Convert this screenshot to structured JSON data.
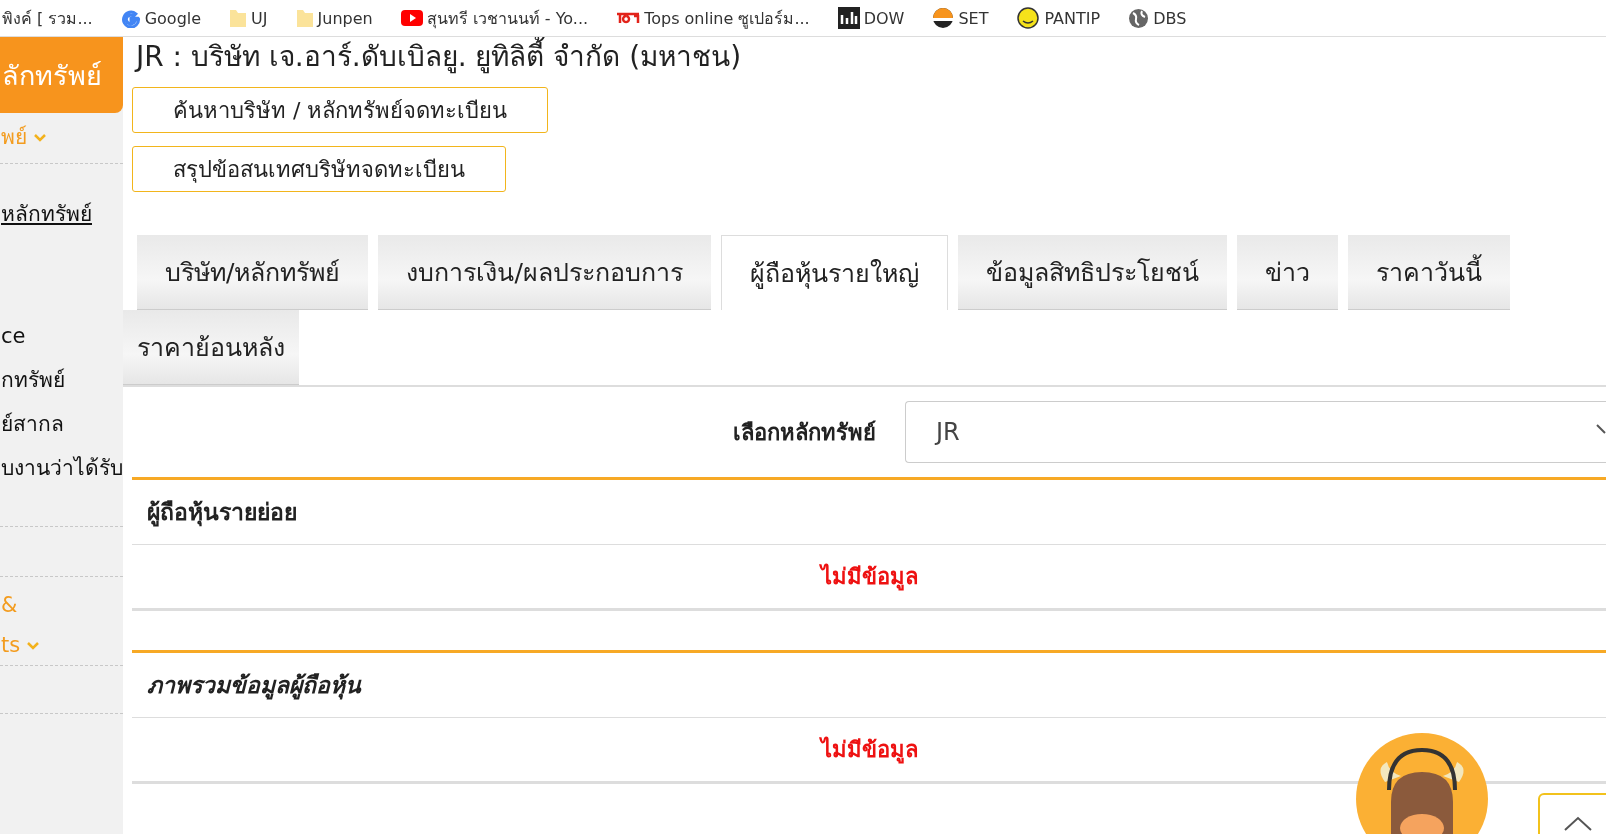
{
  "bookmarks": [
    {
      "label": "พิงค์ [ รวม...",
      "kind": "none"
    },
    {
      "label": "Google",
      "kind": "google"
    },
    {
      "label": "UJ",
      "kind": "folder"
    },
    {
      "label": "Junpen",
      "kind": "folder"
    },
    {
      "label": "สุนทรี เวชานนท์ - Yo...",
      "kind": "video"
    },
    {
      "label": "Tops online ซูเปอร์ม...",
      "kind": "shop"
    },
    {
      "label": "DOW",
      "kind": "chart"
    },
    {
      "label": "SET",
      "kind": "sun"
    },
    {
      "label": "PANTIP",
      "kind": "smile"
    },
    {
      "label": "DBS",
      "kind": "globe"
    }
  ],
  "sidebar": {
    "header": "ลักทรัพย์",
    "sections": [
      {
        "items": [
          {
            "kind": "dropdown",
            "lines": [
              "พย์"
            ]
          }
        ]
      },
      {
        "items": [
          {
            "kind": "link",
            "lines": [
              "หลักทรัพย์"
            ]
          },
          {
            "kind": "text",
            "lines": [
              "ce"
            ]
          },
          {
            "kind": "text",
            "lines": [
              "กทรัพย์"
            ]
          },
          {
            "kind": "text",
            "lines": [
              "ย์สากล"
            ]
          },
          {
            "kind": "text",
            "lines": [
              "บงานว่าได้รับ"
            ]
          }
        ]
      },
      {
        "items": [
          {
            "kind": "dropdown",
            "lines": [
              "&",
              "ts"
            ]
          }
        ]
      }
    ]
  },
  "title": "JR : บริษัท เจ.อาร์.ดับเบิลยู. ยูทิลิตี้ จำกัด (มหาชน)",
  "buttons": [
    "ค้นหาบริษัท / หลักทรัพย์จดทะเบียน",
    "สรุปข้อสนเทศบริษัทจดทะเบียน"
  ],
  "tabs": [
    {
      "label": "บริษัท/หลักทรัพย์",
      "selected": false
    },
    {
      "label": "งบการเงิน/ผลประกอบการ",
      "selected": false
    },
    {
      "label": "ผู้ถือหุ้นรายใหญ่",
      "selected": true
    },
    {
      "label": "ข้อมูลสิทธิประโยชน์",
      "selected": false
    },
    {
      "label": "ข่าว",
      "selected": false
    },
    {
      "label": "ราคาวันนี้",
      "selected": false
    },
    {
      "label": "ราคาย้อนหลัง",
      "selected": false
    }
  ],
  "security_select": {
    "label": "เลือกหลักทรัพย์",
    "value": "JR"
  },
  "sections": [
    {
      "title": "ผู้ถือหุ้นรายย่อย",
      "message": "ไม่มีข้อมูล"
    },
    {
      "title": "ภาพรวมข้อมูลผู้ถือหุ้น",
      "message": "ไม่มีข้อมูล"
    }
  ]
}
